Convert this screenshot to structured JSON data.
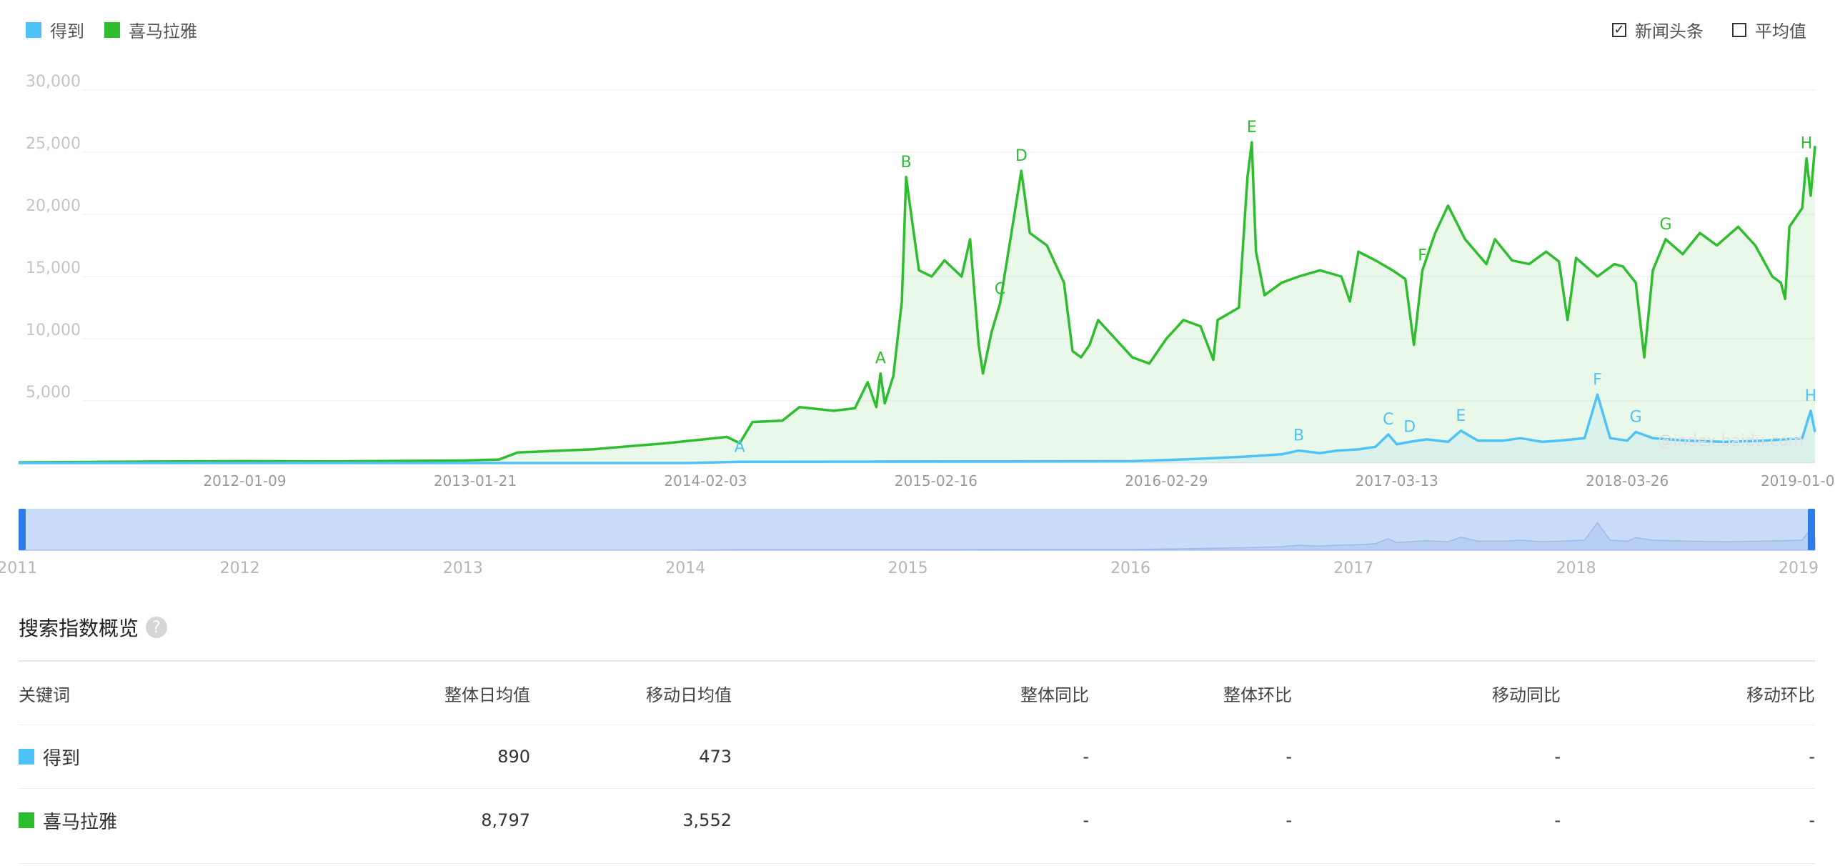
{
  "legend": {
    "items": [
      {
        "label": "得到",
        "color": "#4fc3f7"
      },
      {
        "label": "喜马拉雅",
        "color": "#2ebd2e"
      }
    ]
  },
  "options": [
    {
      "label": "新闻头条",
      "checked": true
    },
    {
      "label": "平均值",
      "checked": false
    }
  ],
  "watermark": "@index.baidu.com",
  "chart_data": {
    "type": "area",
    "ylim": [
      0,
      30000
    ],
    "y_ticks": [
      "5,000",
      "10,000",
      "15,000",
      "20,000",
      "25,000",
      "30,000"
    ],
    "y_tick_values": [
      5000,
      10000,
      15000,
      20000,
      25000,
      30000
    ],
    "x_tick_labels": [
      "2012-01-09",
      "2013-01-21",
      "2014-02-03",
      "2015-02-16",
      "2016-02-29",
      "2017-03-13",
      "2018-03-26",
      "2019-01-07"
    ],
    "x_tick_dates": [
      "2012-01-09",
      "2013-01-21",
      "2014-02-03",
      "2015-02-16",
      "2016-02-29",
      "2017-03-13",
      "2018-03-26",
      "2019-01-07"
    ],
    "x_range": [
      "2011-01-03",
      "2019-01-28"
    ],
    "series": [
      {
        "name": "喜马拉雅",
        "color": "#2ebd2e",
        "points": [
          [
            "2011-01-03",
            50
          ],
          [
            "2011-06-01",
            100
          ],
          [
            "2012-01-01",
            150
          ],
          [
            "2012-06-01",
            130
          ],
          [
            "2013-01-01",
            200
          ],
          [
            "2013-03-01",
            280
          ],
          [
            "2013-04-01",
            850
          ],
          [
            "2013-08-01",
            1100
          ],
          [
            "2013-12-01",
            1600
          ],
          [
            "2014-03-10",
            2100
          ],
          [
            "2014-03-31",
            1600
          ],
          [
            "2014-04-21",
            3300
          ],
          [
            "2014-06-09",
            3400
          ],
          [
            "2014-07-07",
            4500
          ],
          [
            "2014-09-01",
            4200
          ],
          [
            "2014-10-06",
            4400
          ],
          [
            "2014-10-27",
            6500
          ],
          [
            "2014-11-10",
            4500
          ],
          [
            "2014-11-17",
            7200
          ],
          [
            "2014-11-24",
            4800
          ],
          [
            "2014-12-08",
            7000
          ],
          [
            "2014-12-22",
            13000
          ],
          [
            "2014-12-29",
            23000
          ],
          [
            "2015-01-05",
            20500
          ],
          [
            "2015-01-19",
            15500
          ],
          [
            "2015-02-09",
            15000
          ],
          [
            "2015-03-02",
            16300
          ],
          [
            "2015-03-30",
            15000
          ],
          [
            "2015-04-13",
            18000
          ],
          [
            "2015-04-27",
            9500
          ],
          [
            "2015-05-04",
            7200
          ],
          [
            "2015-05-18",
            10500
          ],
          [
            "2015-06-01",
            12800
          ],
          [
            "2015-06-22",
            19200
          ],
          [
            "2015-07-06",
            23500
          ],
          [
            "2015-07-20",
            18500
          ],
          [
            "2015-08-17",
            17500
          ],
          [
            "2015-09-14",
            14500
          ],
          [
            "2015-09-28",
            9000
          ],
          [
            "2015-10-12",
            8500
          ],
          [
            "2015-10-26",
            9500
          ],
          [
            "2015-11-09",
            11500
          ],
          [
            "2015-12-07",
            10000
          ],
          [
            "2016-01-04",
            8500
          ],
          [
            "2016-02-01",
            8000
          ],
          [
            "2016-02-29",
            10000
          ],
          [
            "2016-03-28",
            11500
          ],
          [
            "2016-04-25",
            11000
          ],
          [
            "2016-05-16",
            8300
          ],
          [
            "2016-05-23",
            11500
          ],
          [
            "2016-06-27",
            12500
          ],
          [
            "2016-07-11",
            23000
          ],
          [
            "2016-07-18",
            25800
          ],
          [
            "2016-07-25",
            17000
          ],
          [
            "2016-08-08",
            13500
          ],
          [
            "2016-09-05",
            14500
          ],
          [
            "2016-10-03",
            15000
          ],
          [
            "2016-11-07",
            15500
          ],
          [
            "2016-12-12",
            15000
          ],
          [
            "2016-12-26",
            13000
          ],
          [
            "2017-01-09",
            17000
          ],
          [
            "2017-02-06",
            16300
          ],
          [
            "2017-03-06",
            15500
          ],
          [
            "2017-03-27",
            14800
          ],
          [
            "2017-04-10",
            9500
          ],
          [
            "2017-04-24",
            15500
          ],
          [
            "2017-05-15",
            18500
          ],
          [
            "2017-06-05",
            20700
          ],
          [
            "2017-07-03",
            18000
          ],
          [
            "2017-08-07",
            16000
          ],
          [
            "2017-08-21",
            18000
          ],
          [
            "2017-09-18",
            16300
          ],
          [
            "2017-10-16",
            16000
          ],
          [
            "2017-11-13",
            17000
          ],
          [
            "2017-12-04",
            16200
          ],
          [
            "2017-12-18",
            11500
          ],
          [
            "2018-01-01",
            16500
          ],
          [
            "2018-02-05",
            15000
          ],
          [
            "2018-03-05",
            16000
          ],
          [
            "2018-03-19",
            15800
          ],
          [
            "2018-04-09",
            14500
          ],
          [
            "2018-04-23",
            8500
          ],
          [
            "2018-05-07",
            15500
          ],
          [
            "2018-05-28",
            18000
          ],
          [
            "2018-06-25",
            16800
          ],
          [
            "2018-07-23",
            18500
          ],
          [
            "2018-08-20",
            17500
          ],
          [
            "2018-09-24",
            19000
          ],
          [
            "2018-10-22",
            17500
          ],
          [
            "2018-11-19",
            15000
          ],
          [
            "2018-12-03",
            14500
          ],
          [
            "2018-12-10",
            13200
          ],
          [
            "2018-12-17",
            19000
          ],
          [
            "2018-12-31",
            20000
          ],
          [
            "2019-01-07",
            20500
          ],
          [
            "2019-01-14",
            24500
          ],
          [
            "2019-01-21",
            21500
          ],
          [
            "2019-01-28",
            25500
          ]
        ]
      },
      {
        "name": "得到",
        "color": "#4fc3f7",
        "points": [
          [
            "2011-01-03",
            0
          ],
          [
            "2014-01-06",
            0
          ],
          [
            "2014-03-31",
            100
          ],
          [
            "2015-01-05",
            120
          ],
          [
            "2015-06-01",
            130
          ],
          [
            "2016-01-04",
            150
          ],
          [
            "2016-04-04",
            300
          ],
          [
            "2016-07-04",
            500
          ],
          [
            "2016-09-05",
            700
          ],
          [
            "2016-10-03",
            1000
          ],
          [
            "2016-11-07",
            800
          ],
          [
            "2016-12-05",
            1000
          ],
          [
            "2017-01-09",
            1100
          ],
          [
            "2017-02-06",
            1300
          ],
          [
            "2017-02-27",
            2300
          ],
          [
            "2017-03-13",
            1500
          ],
          [
            "2017-04-03",
            1700
          ],
          [
            "2017-05-01",
            1900
          ],
          [
            "2017-06-05",
            1700
          ],
          [
            "2017-06-26",
            2600
          ],
          [
            "2017-07-24",
            1800
          ],
          [
            "2017-09-04",
            1800
          ],
          [
            "2017-10-02",
            2000
          ],
          [
            "2017-11-06",
            1700
          ],
          [
            "2017-12-04",
            1800
          ],
          [
            "2018-01-15",
            2000
          ],
          [
            "2018-02-05",
            5500
          ],
          [
            "2018-02-26",
            2000
          ],
          [
            "2018-03-26",
            1800
          ],
          [
            "2018-04-09",
            2500
          ],
          [
            "2018-05-07",
            2000
          ],
          [
            "2018-07-02",
            1800
          ],
          [
            "2018-09-03",
            1700
          ],
          [
            "2018-11-05",
            1800
          ],
          [
            "2019-01-07",
            2000
          ],
          [
            "2019-01-21",
            4200
          ],
          [
            "2019-01-28",
            2500
          ]
        ]
      }
    ],
    "annotations": [
      {
        "series": "喜马拉雅",
        "label": "A",
        "date": "2014-11-17",
        "value": 7200
      },
      {
        "series": "喜马拉雅",
        "label": "B",
        "date": "2014-12-29",
        "value": 23000
      },
      {
        "series": "喜马拉雅",
        "label": "C",
        "date": "2015-06-01",
        "value": 12800
      },
      {
        "series": "喜马拉雅",
        "label": "D",
        "date": "2015-07-06",
        "value": 23500
      },
      {
        "series": "喜马拉雅",
        "label": "E",
        "date": "2016-07-18",
        "value": 25800
      },
      {
        "series": "喜马拉雅",
        "label": "F",
        "date": "2017-04-24",
        "value": 15500
      },
      {
        "series": "喜马拉雅",
        "label": "G",
        "date": "2018-05-28",
        "value": 18000
      },
      {
        "series": "喜马拉雅",
        "label": "H",
        "date": "2019-01-14",
        "value": 24500
      },
      {
        "series": "得到",
        "label": "A",
        "date": "2014-03-31",
        "value": 100
      },
      {
        "series": "得到",
        "label": "B",
        "date": "2016-10-03",
        "value": 1000
      },
      {
        "series": "得到",
        "label": "C",
        "date": "2017-02-27",
        "value": 2300
      },
      {
        "series": "得到",
        "label": "D",
        "date": "2017-04-03",
        "value": 1700
      },
      {
        "series": "得到",
        "label": "E",
        "date": "2017-06-26",
        "value": 2600
      },
      {
        "series": "得到",
        "label": "F",
        "date": "2018-02-05",
        "value": 5500
      },
      {
        "series": "得到",
        "label": "G",
        "date": "2018-04-09",
        "value": 2500
      },
      {
        "series": "得到",
        "label": "H",
        "date": "2019-01-21",
        "value": 4200
      }
    ],
    "navigator": {
      "year_labels": [
        "2011",
        "2012",
        "2013",
        "2014",
        "2015",
        "2016",
        "2017",
        "2018",
        "2019"
      ],
      "year_dates": [
        "2011-01-01",
        "2012-01-01",
        "2013-01-01",
        "2014-01-01",
        "2015-01-01",
        "2016-01-01",
        "2017-01-01",
        "2018-01-01",
        "2019-01-01"
      ]
    }
  },
  "summary": {
    "title": "搜索指数概览",
    "help": "?",
    "headers": [
      "关键词",
      "整体日均值",
      "移动日均值",
      "整体同比",
      "整体环比",
      "移动同比",
      "移动环比"
    ],
    "rows": [
      {
        "keyword": "得到",
        "color": "#4fc3f7",
        "values": [
          "890",
          "473",
          "-",
          "-",
          "-",
          "-"
        ]
      },
      {
        "keyword": "喜马拉雅",
        "color": "#2ebd2e",
        "values": [
          "8,797",
          "3,552",
          "-",
          "-",
          "-",
          "-"
        ]
      }
    ]
  }
}
